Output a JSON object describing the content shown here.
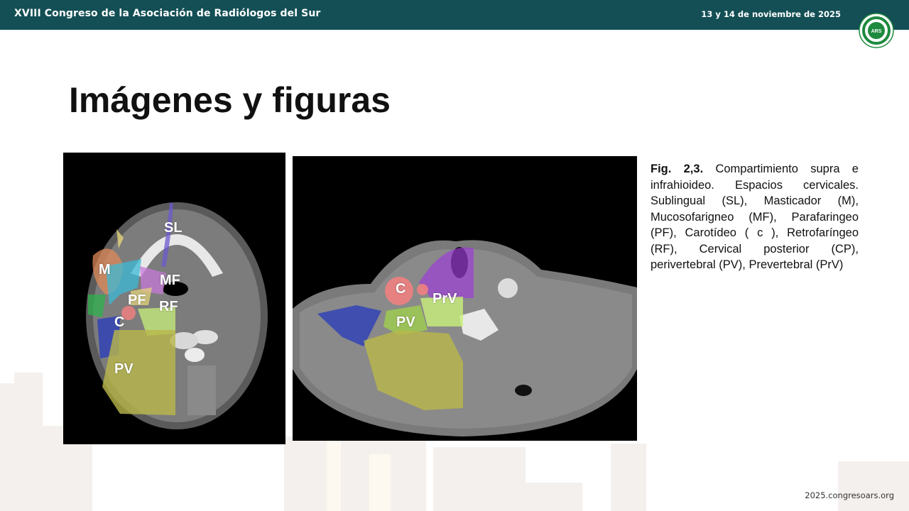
{
  "header": {
    "conference_title": "XVIII Congreso de la Asociación de Radiólogos del Sur",
    "dates": "13 y 14 de noviembre de 2025",
    "logo_text": "ARS",
    "logo_ring_text": "ASOCIACIÓN RADIÓLOGOS SUR",
    "logo_color": "#1e8a3e"
  },
  "slide": {
    "title": "Imágenes y figuras"
  },
  "figure1": {
    "labels": {
      "sl": "SL",
      "m": "M",
      "mf": "MF",
      "pf": "PF",
      "rf": "RF",
      "c": "C",
      "pv": "PV"
    }
  },
  "figure2": {
    "labels": {
      "c": "C",
      "prv": "PrV",
      "pv": "PV"
    }
  },
  "caption": {
    "fig_ref": "Fig. 2,3.",
    "text": " Compartimiento supra e infrahioideo. Espacios cervicales. Sublingual (SL), Masticador (M), Mucosofarigneo (MF), Parafaringeo (PF), Carotídeo ( c ), Retrofaríngeo (RF), Cervical posterior (CP), perivertebral (PV), Prevertebral (PrV)"
  },
  "footer": {
    "url": "2025.congresoars.org"
  },
  "colors": {
    "header_bg": "#134f55",
    "sublingual": "#6a5acd",
    "masticador": "#e08a5a",
    "mucosofaringeo": "#c77ad8",
    "parafaringeo": "#3bb9d6",
    "carotideo": "#f08080",
    "retrofaringeo": "#c8f07a",
    "perivertebral": "#b9b84a",
    "cervical_posterior": "#2c3fb8",
    "prevertebral": "#9b3fd6"
  }
}
